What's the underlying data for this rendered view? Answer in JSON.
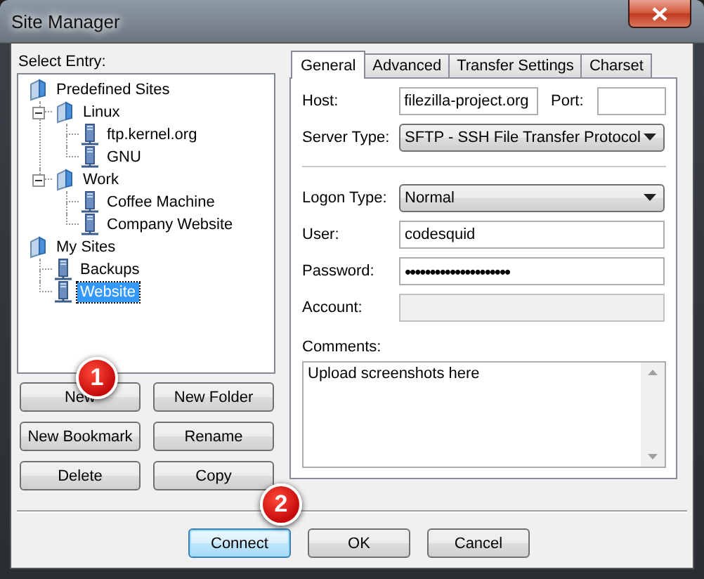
{
  "window": {
    "title": "Site Manager"
  },
  "select_entry_label": "Select Entry:",
  "tree": [
    {
      "label": "Predefined Sites",
      "kind": "folder",
      "selected": false,
      "children": [
        {
          "label": "Linux",
          "kind": "folder",
          "expanded": true,
          "selected": false,
          "children": [
            {
              "label": "ftp.kernel.org",
              "kind": "site",
              "selected": false
            },
            {
              "label": "GNU",
              "kind": "site",
              "selected": false
            }
          ]
        },
        {
          "label": "Work",
          "kind": "folder",
          "expanded": true,
          "selected": false,
          "children": [
            {
              "label": "Coffee Machine",
              "kind": "site",
              "selected": false
            },
            {
              "label": "Company Website",
              "kind": "site",
              "selected": false
            }
          ]
        }
      ]
    },
    {
      "label": "My Sites",
      "kind": "folder",
      "selected": false,
      "children": [
        {
          "label": "Backups",
          "kind": "site",
          "selected": false
        },
        {
          "label": "Website",
          "kind": "site",
          "selected": true
        }
      ]
    }
  ],
  "entry_buttons": [
    "New",
    "New Folder",
    "New Bookmark",
    "Rename",
    "Delete",
    "Copy"
  ],
  "tabs": [
    {
      "label": "General",
      "selected": true
    },
    {
      "label": "Advanced",
      "selected": false
    },
    {
      "label": "Transfer Settings",
      "selected": false
    },
    {
      "label": "Charset",
      "selected": false
    }
  ],
  "general": {
    "host": {
      "label": "Host:",
      "value": "filezilla-project.org"
    },
    "port": {
      "label": "Port:"
    },
    "server_type": {
      "label": "Server Type:",
      "value": "SFTP - SSH File Transfer Protocol"
    },
    "logon_fields": [
      {
        "label": "Logon Type:",
        "kind": "select",
        "value": "Normal",
        "disabled": false
      },
      {
        "label": "User:",
        "kind": "text",
        "value": "codesquid",
        "disabled": false
      },
      {
        "label": "Password:",
        "kind": "text",
        "value": "•••••••••••••••••••••",
        "disabled": false
      },
      {
        "label": "Account:",
        "kind": "text",
        "disabled": true
      }
    ],
    "comments": {
      "label": "Comments:",
      "value": "Upload screenshots here"
    }
  },
  "dialog_buttons": [
    {
      "label": "Connect",
      "focused": true
    },
    {
      "label": "OK",
      "focused": false
    },
    {
      "label": "Cancel",
      "focused": false
    }
  ],
  "badges": [
    {
      "label": "1"
    },
    {
      "label": "2"
    }
  ]
}
